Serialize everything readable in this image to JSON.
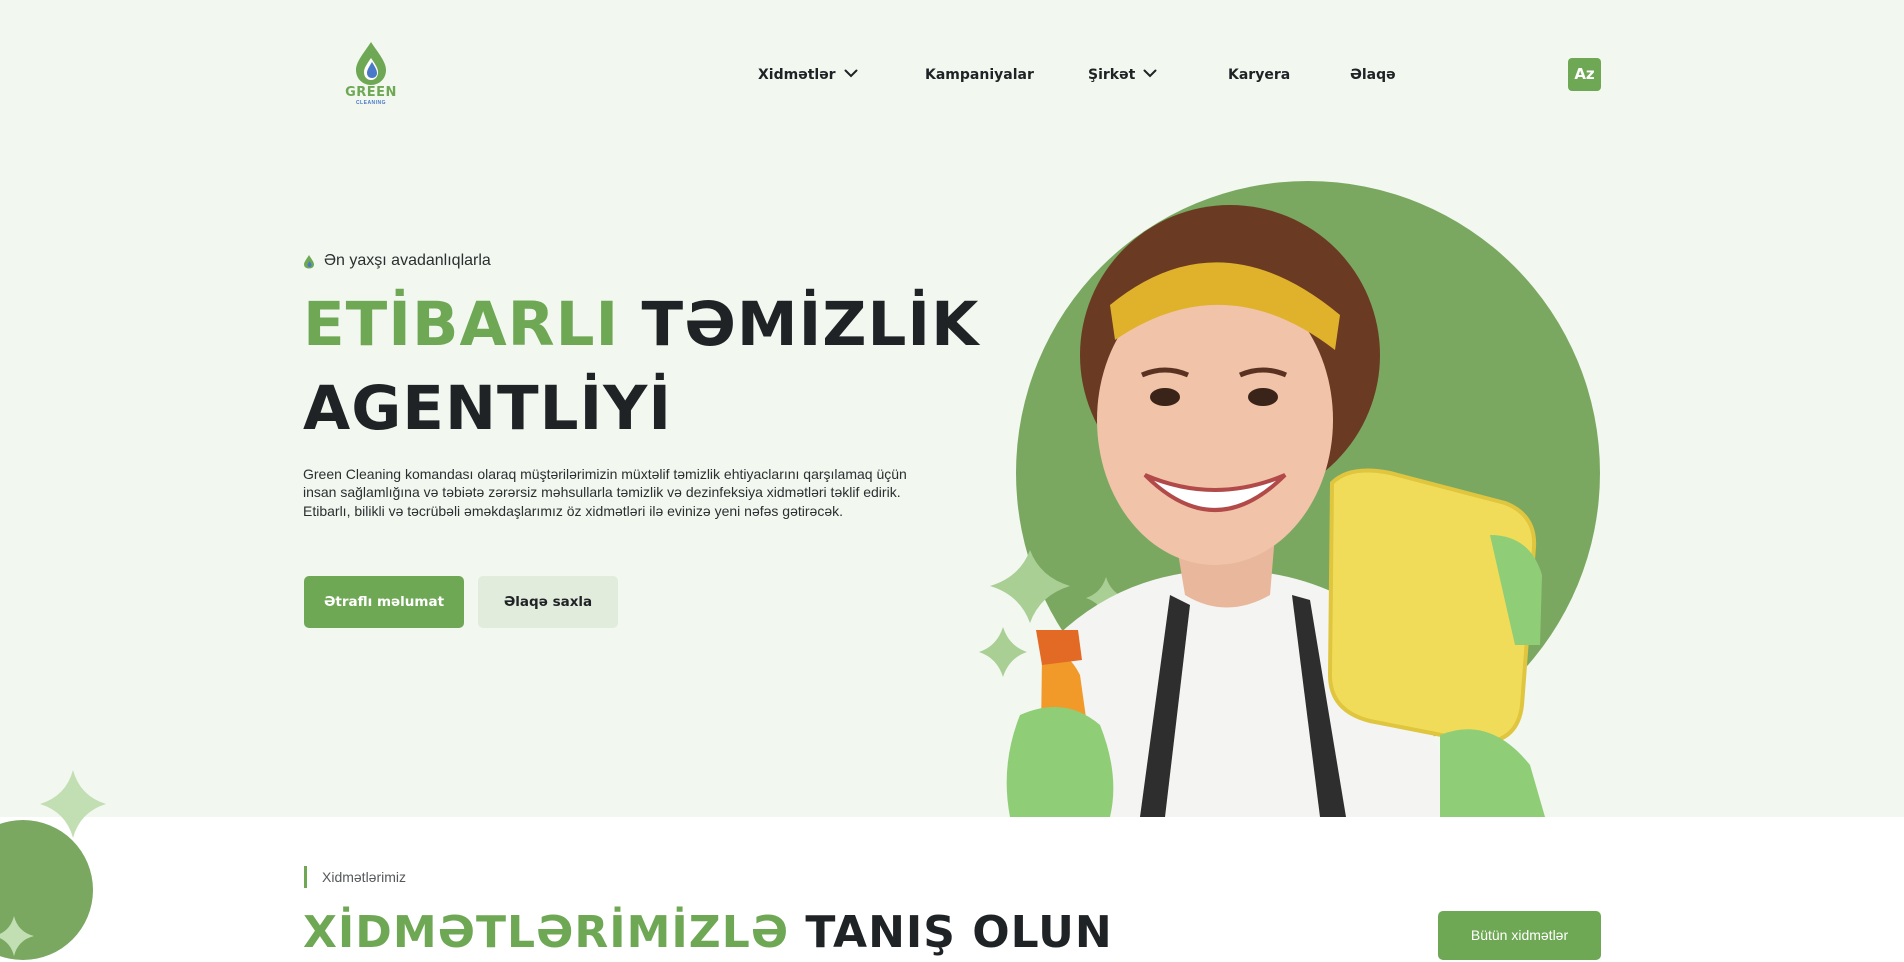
{
  "header": {
    "logo": {
      "word": "GREEN",
      "sub": "CLEANING"
    },
    "nav": [
      {
        "label": "Xidmətlər",
        "has_dropdown": true
      },
      {
        "label": "Kampaniyalar",
        "has_dropdown": false
      },
      {
        "label": "Şirkət",
        "has_dropdown": true
      },
      {
        "label": "Karyera",
        "has_dropdown": false
      },
      {
        "label": "Əlaqə",
        "has_dropdown": false
      }
    ],
    "language": "Az"
  },
  "hero": {
    "eyebrow": "Ən yaxşı avadanlıqlarla",
    "title_accent": "ETİBARLI",
    "title_rest": "TƏMİZLİK AGENTLİYİ",
    "description": "Green Cleaning komandası olaraq müştərilərimizin müxtəlif təmizlik ehtiyaclarını qarşılamaq üçün insan sağlamlığına və təbiətə zərərsiz məhsullarla təmizlik və dezinfeksiya xidmətləri təklif edirik. Etibarlı, bilikli və təcrübəli əməkdaşlarımız öz xidmətləri ilə evinizə yeni nəfəs gətirəcək.",
    "primary_button": "Ətraflı məlumat",
    "secondary_button": "Əlaqə saxla"
  },
  "services": {
    "eyebrow": "Xidmətlərimiz",
    "title_accent": "XİDMƏTLƏRİMİZLƏ",
    "title_rest": "TANIŞ OLUN",
    "all_button": "Bütün xidmətlər"
  },
  "colors": {
    "accent": "#6fa855",
    "background": "#f2f7f0",
    "text": "#1f2326"
  }
}
